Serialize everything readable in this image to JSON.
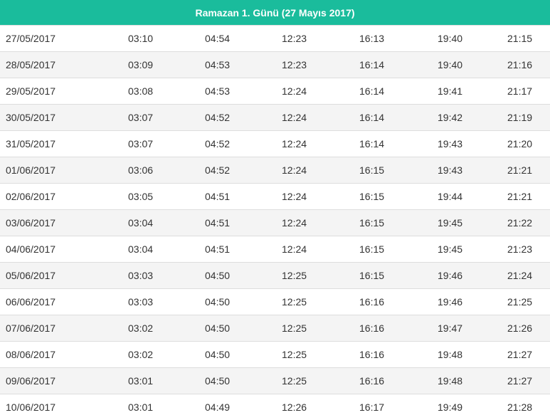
{
  "header": {
    "title": "Ramazan 1. Günü (27 Mayıs 2017)"
  },
  "rows": [
    [
      "27/05/2017",
      "03:10",
      "04:54",
      "12:23",
      "16:13",
      "19:40",
      "21:15"
    ],
    [
      "28/05/2017",
      "03:09",
      "04:53",
      "12:23",
      "16:14",
      "19:40",
      "21:16"
    ],
    [
      "29/05/2017",
      "03:08",
      "04:53",
      "12:24",
      "16:14",
      "19:41",
      "21:17"
    ],
    [
      "30/05/2017",
      "03:07",
      "04:52",
      "12:24",
      "16:14",
      "19:42",
      "21:19"
    ],
    [
      "31/05/2017",
      "03:07",
      "04:52",
      "12:24",
      "16:14",
      "19:43",
      "21:20"
    ],
    [
      "01/06/2017",
      "03:06",
      "04:52",
      "12:24",
      "16:15",
      "19:43",
      "21:21"
    ],
    [
      "02/06/2017",
      "03:05",
      "04:51",
      "12:24",
      "16:15",
      "19:44",
      "21:21"
    ],
    [
      "03/06/2017",
      "03:04",
      "04:51",
      "12:24",
      "16:15",
      "19:45",
      "21:22"
    ],
    [
      "04/06/2017",
      "03:04",
      "04:51",
      "12:24",
      "16:15",
      "19:45",
      "21:23"
    ],
    [
      "05/06/2017",
      "03:03",
      "04:50",
      "12:25",
      "16:15",
      "19:46",
      "21:24"
    ],
    [
      "06/06/2017",
      "03:03",
      "04:50",
      "12:25",
      "16:16",
      "19:46",
      "21:25"
    ],
    [
      "07/06/2017",
      "03:02",
      "04:50",
      "12:25",
      "16:16",
      "19:47",
      "21:26"
    ],
    [
      "08/06/2017",
      "03:02",
      "04:50",
      "12:25",
      "16:16",
      "19:48",
      "21:27"
    ],
    [
      "09/06/2017",
      "03:01",
      "04:50",
      "12:25",
      "16:16",
      "19:48",
      "21:27"
    ],
    [
      "10/06/2017",
      "03:01",
      "04:49",
      "12:26",
      "16:17",
      "19:49",
      "21:28"
    ]
  ]
}
